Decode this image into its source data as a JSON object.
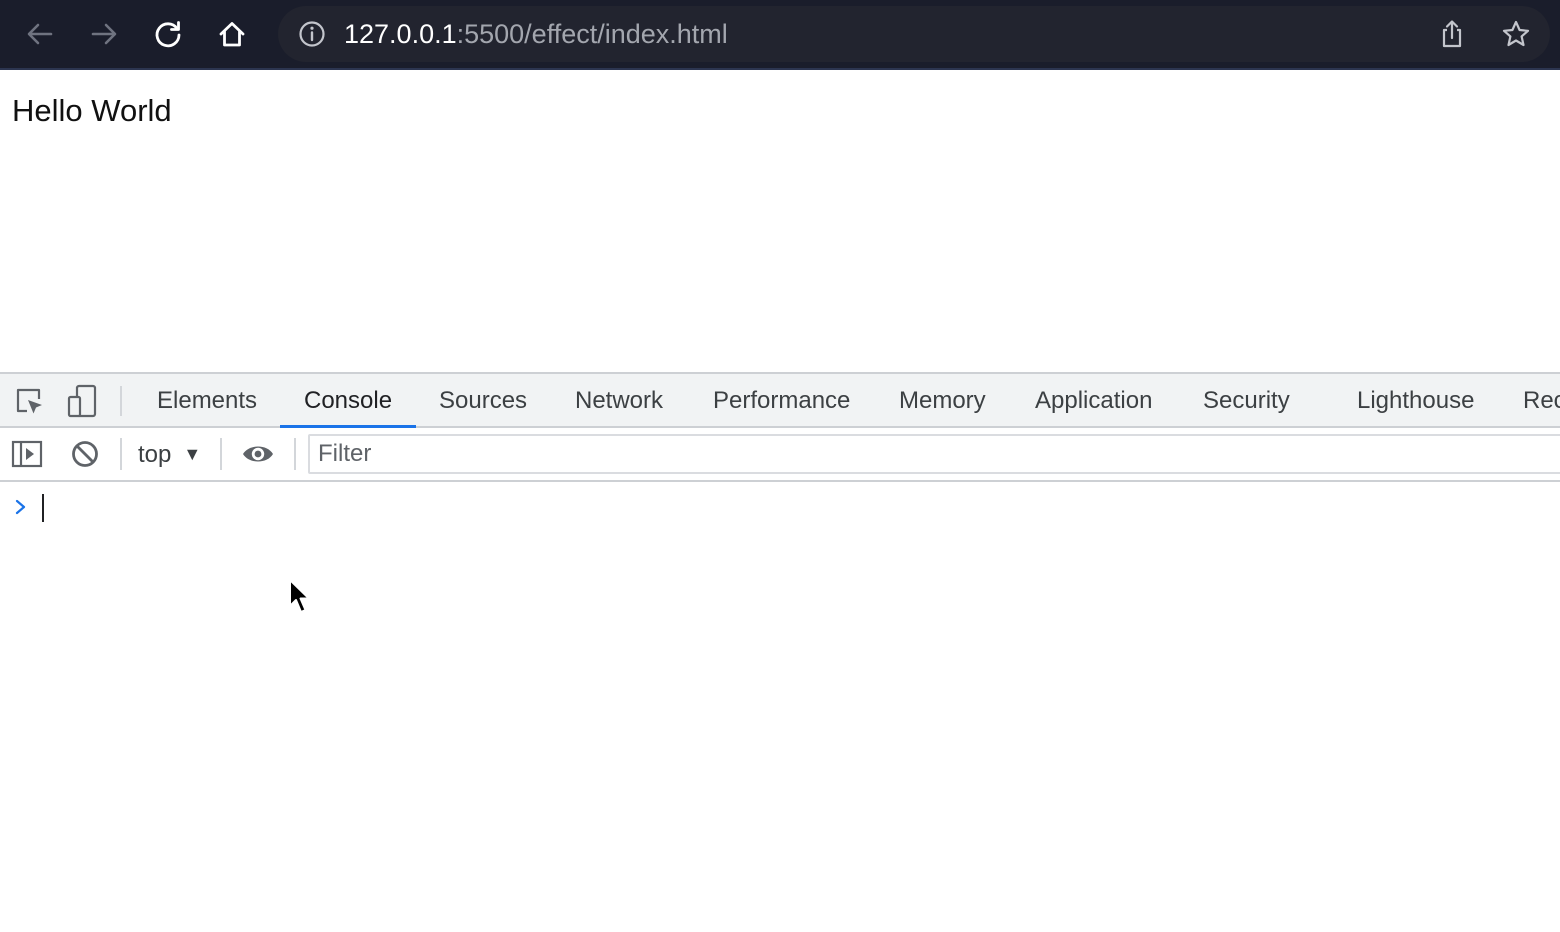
{
  "browser": {
    "url_host": "127.0.0.1",
    "url_path": ":5500/effect/index.html",
    "icons": {
      "back": "arrow-left-icon",
      "forward": "arrow-right-icon",
      "reload": "reload-icon",
      "home": "home-icon",
      "site_info": "info-circle-icon",
      "share": "share-icon",
      "bookmark": "star-icon"
    }
  },
  "page": {
    "heading": "Hello World"
  },
  "devtools": {
    "tabs": [
      {
        "label": "Elements"
      },
      {
        "label": "Console",
        "active": true
      },
      {
        "label": "Sources"
      },
      {
        "label": "Network"
      },
      {
        "label": "Performance"
      },
      {
        "label": "Memory"
      },
      {
        "label": "Application"
      },
      {
        "label": "Security"
      },
      {
        "label": "Lighthouse"
      },
      {
        "label": "Rec"
      }
    ],
    "console": {
      "context": "top",
      "filter_placeholder": "Filter",
      "filter_value": ""
    },
    "colors": {
      "accent": "#1a73e8",
      "prompt": "#1a73e8"
    }
  }
}
